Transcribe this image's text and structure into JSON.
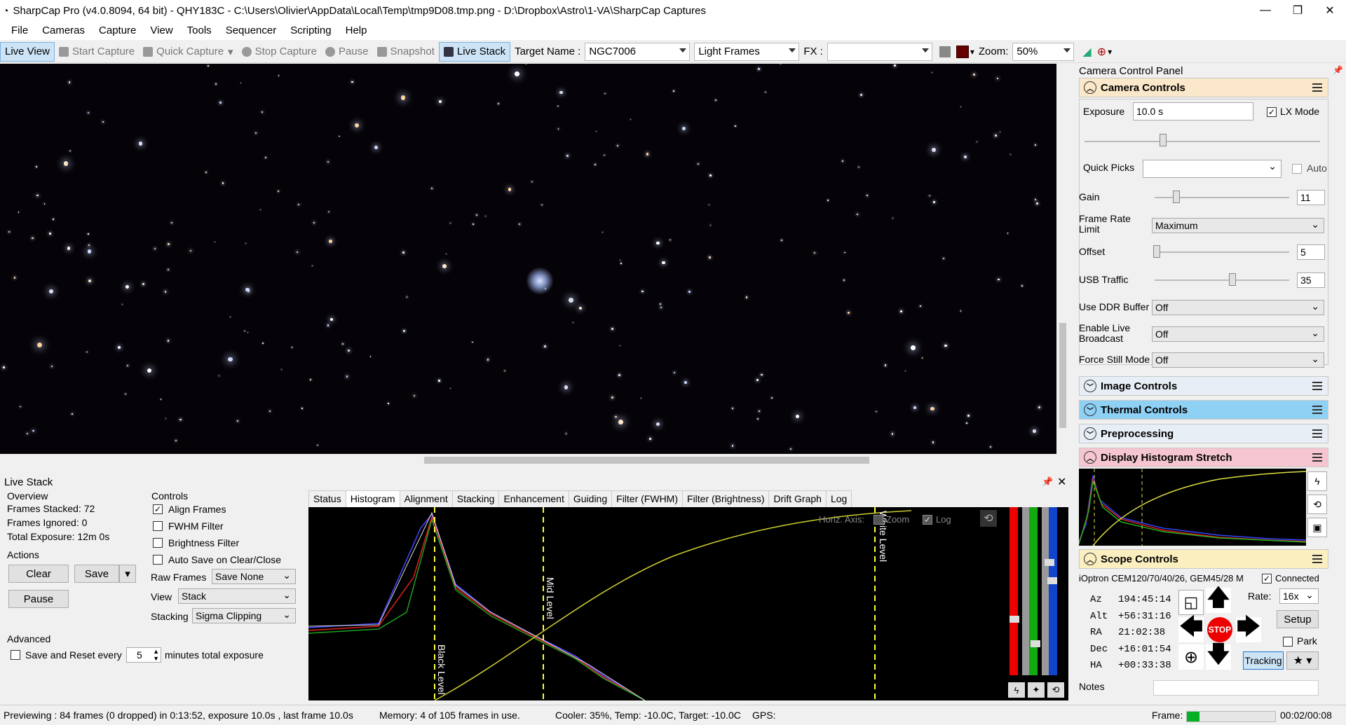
{
  "window": {
    "title": "SharpCap Pro (v4.0.8094, 64 bit) - QHY183C - C:\\Users\\Olivier\\AppData\\Local\\Temp\\tmp9D08.tmp.png - D:\\Dropbox\\Astro\\1-VA\\SharpCap Captures"
  },
  "menu": [
    "File",
    "Cameras",
    "Capture",
    "View",
    "Tools",
    "Sequencer",
    "Scripting",
    "Help"
  ],
  "toolbar": {
    "live_view": "Live View",
    "start_capture": "Start Capture",
    "quick_capture": "Quick Capture",
    "stop_capture": "Stop Capture",
    "pause": "Pause",
    "snapshot": "Snapshot",
    "live_stack": "Live Stack",
    "target_label": "Target Name :",
    "target_value": "NGC7006",
    "frame_type": "Light Frames",
    "fx_label": "FX :",
    "fx_value": "",
    "zoom_label": "Zoom:",
    "zoom_value": "50%"
  },
  "livestack": {
    "title": "Live Stack",
    "overview_label": "Overview",
    "frames_stacked": "Frames Stacked: 72",
    "frames_ignored": "Frames Ignored:  0",
    "total_exposure": "Total Exposure:   12m 0s",
    "actions_label": "Actions",
    "clear": "Clear",
    "save": "Save",
    "pause": "Pause",
    "controls_label": "Controls",
    "align_frames": "Align Frames",
    "fwhm_filter": "FWHM Filter",
    "brightness_filter": "Brightness Filter",
    "auto_save": "Auto Save on Clear/Close",
    "raw_frames_label": "Raw Frames",
    "raw_frames_value": "Save None",
    "view_label": "View",
    "view_value": "Stack",
    "stacking_label": "Stacking",
    "stacking_value": "Sigma Clipping",
    "advanced_label": "Advanced",
    "save_reset": "Save and Reset every",
    "reset_minutes": "5",
    "minutes_suffix": "minutes total exposure",
    "tabs": [
      "Status",
      "Histogram",
      "Alignment",
      "Stacking",
      "Enhancement",
      "Guiding",
      "Filter (FWHM)",
      "Filter (Brightness)",
      "Drift Graph",
      "Log"
    ],
    "horiz_axis": "Horiz. Axis:",
    "zoom": "Zoom",
    "log": "Log",
    "black_level": "Black Level",
    "mid_level": "Mid Level",
    "white_level": "White Level"
  },
  "ccp": {
    "title": "Camera Control Panel",
    "camera_controls": "Camera Controls",
    "exposure_label": "Exposure",
    "exposure_value": "10.0 s",
    "lx_mode": "LX Mode",
    "quick_picks": "Quick Picks",
    "auto": "Auto",
    "gain_label": "Gain",
    "gain_value": "11",
    "frame_rate_label": "Frame Rate Limit",
    "frame_rate_value": "Maximum",
    "offset_label": "Offset",
    "offset_value": "5",
    "usb_label": "USB Traffic",
    "usb_value": "35",
    "ddr_label": "Use DDR Buffer",
    "ddr_value": "Off",
    "broadcast_label": "Enable Live Broadcast",
    "broadcast_value": "Off",
    "still_label": "Force Still Mode",
    "still_value": "Off",
    "image_controls": "Image Controls",
    "thermal_controls": "Thermal Controls",
    "preprocessing": "Preprocessing",
    "display_histogram": "Display Histogram Stretch",
    "scope_controls": "Scope Controls",
    "scope_name": "iOptron CEM120/70/40/26, GEM45/28 M",
    "connected": "Connected",
    "az_label": "Az",
    "az_value": "194:45:14",
    "alt_label": "Alt",
    "alt_value": "+56:31:16",
    "ra_label": "RA",
    "ra_value": "21:02:38",
    "dec_label": "Dec",
    "dec_value": "+16:01:54",
    "ha_label": "HA",
    "ha_value": "+00:33:38",
    "rate_label": "Rate:",
    "rate_value": "16x",
    "setup": "Setup",
    "park": "Park",
    "stop": "STOP",
    "tracking": "Tracking",
    "notes": "Notes"
  },
  "status": {
    "preview": "Previewing : 84 frames (0 dropped) in 0:13:52, exposure 10.0s , last frame 10.0s",
    "memory": "Memory: 4 of 105 frames in use.",
    "cooler": "Cooler: 35%, Temp: -10.0C, Target: -10.0C",
    "gps": "GPS:",
    "frame_label": "Frame:",
    "frame_time": "00:02/00:08"
  }
}
